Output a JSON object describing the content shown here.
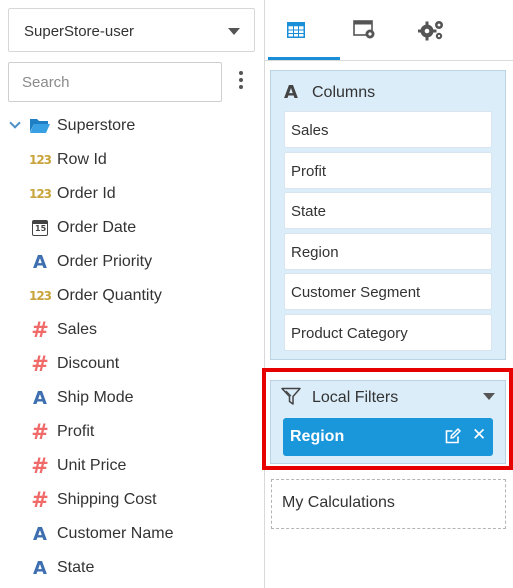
{
  "left": {
    "datasource": "SuperStore-user",
    "search_placeholder": "Search",
    "root": "Superstore",
    "fields": [
      {
        "label": "Row Id",
        "icon": "numeric-icon"
      },
      {
        "label": "Order Id",
        "icon": "numeric-icon"
      },
      {
        "label": "Order Date",
        "icon": "date-icon"
      },
      {
        "label": "Order Priority",
        "icon": "text-icon"
      },
      {
        "label": "Order Quantity",
        "icon": "numeric-icon"
      },
      {
        "label": "Sales",
        "icon": "measure-icon"
      },
      {
        "label": "Discount",
        "icon": "measure-icon"
      },
      {
        "label": "Ship Mode",
        "icon": "text-icon"
      },
      {
        "label": "Profit",
        "icon": "measure-icon"
      },
      {
        "label": "Unit Price",
        "icon": "measure-icon"
      },
      {
        "label": "Shipping Cost",
        "icon": "measure-icon"
      },
      {
        "label": "Customer Name",
        "icon": "text-icon"
      },
      {
        "label": "State",
        "icon": "text-icon"
      }
    ],
    "icon_text": {
      "numeric": "123",
      "measure": "#",
      "text": "A",
      "date": "15"
    }
  },
  "right": {
    "columns_title": "Columns",
    "columns": [
      "Sales",
      "Profit",
      "State",
      "Region",
      "Customer Segment",
      "Product Category"
    ],
    "filters_title": "Local Filters",
    "filter_chip": "Region",
    "close_glyph": "✕",
    "calculations_title": "My Calculations"
  },
  "colors": {
    "accent": "#1a96db",
    "panel": "#dbedf9",
    "highlight": "#e60000"
  }
}
